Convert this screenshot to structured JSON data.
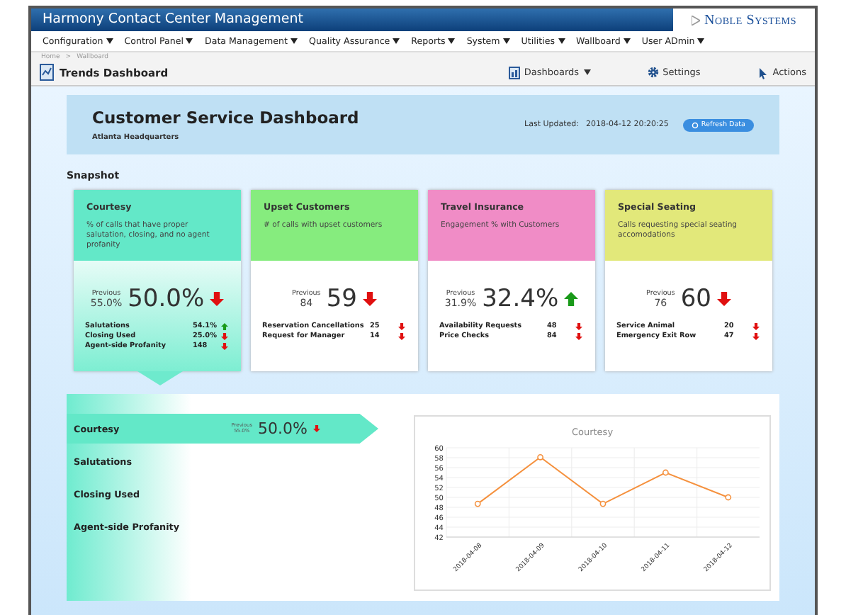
{
  "app": {
    "title": "Harmony Contact Center Management",
    "logo": "Noble Systems"
  },
  "menu": [
    {
      "label": "Configuration"
    },
    {
      "label": "Control Panel"
    },
    {
      "label": "Data Management"
    },
    {
      "label": "Quality Assurance"
    },
    {
      "label": "Reports"
    },
    {
      "label": "System"
    },
    {
      "label": "Utilities"
    },
    {
      "label": "Wallboard"
    },
    {
      "label": "User ADmin"
    }
  ],
  "breadcrumb": [
    "Home",
    ">",
    "Wallboard"
  ],
  "page": {
    "title": "Trends Dashboard",
    "actions": [
      {
        "kind": "dashboards",
        "label": "Dashboards"
      },
      {
        "kind": "settings",
        "label": "Settings"
      },
      {
        "kind": "actions",
        "label": "Actions"
      }
    ]
  },
  "header": {
    "title": "Customer Service Dashboard",
    "subtitle": "Atlanta Headquarters",
    "updated_label": "Last Updated:",
    "updated_value": "2018-04-12 20:20:25",
    "refresh": "Refresh Data"
  },
  "section": "Snapshot",
  "cards": [
    {
      "title": "Courtesy",
      "description": "% of calls that have proper salutation, closing, and no agent profanity",
      "color": "#63e8c8",
      "selected": true,
      "previous_label": "Previous",
      "previous": "55.0%",
      "value": "50.0%",
      "rising": false,
      "metrics": [
        {
          "name": "Salutations",
          "value": "54.1%",
          "rising": true
        },
        {
          "name": "Closing Used",
          "value": "25.0%",
          "rising": false
        },
        {
          "name": "Agent-side Profanity",
          "value": "148",
          "rising": false
        }
      ]
    },
    {
      "title": "Upset Customers",
      "description": "# of calls with upset customers",
      "color": "#86ec7e",
      "selected": false,
      "previous_label": "Previous",
      "previous": "84",
      "value": "59",
      "rising": false,
      "metrics": [
        {
          "name": "Reservation Cancellations",
          "value": "25",
          "rising": false
        },
        {
          "name": "Request for Manager",
          "value": "14",
          "rising": false
        }
      ]
    },
    {
      "title": "Travel Insurance",
      "description": "Engagement % with Customers",
      "color": "#f08cc6",
      "selected": false,
      "previous_label": "Previous",
      "previous": "31.9%",
      "value": "32.4%",
      "rising": true,
      "metrics": [
        {
          "name": "Availability Requests",
          "value": "48",
          "rising": false
        },
        {
          "name": "Price Checks",
          "value": "84",
          "rising": false
        }
      ]
    },
    {
      "title": "Special Seating",
      "description": "Calls requesting special seating accomodations",
      "color": "#e2e87a",
      "selected": false,
      "previous_label": "Previous",
      "previous": "76",
      "value": "60",
      "rising": false,
      "metrics": [
        {
          "name": "Service Animal",
          "value": "20",
          "rising": false
        },
        {
          "name": "Emergency Exit Row",
          "value": "47",
          "rising": false
        }
      ]
    }
  ],
  "detail": {
    "items": [
      {
        "label": "Courtesy",
        "selected": true,
        "previous_label": "Previous",
        "previous": "55.0%",
        "value": "50.0%",
        "rising": false
      },
      {
        "label": "Salutations",
        "selected": false
      },
      {
        "label": "Closing Used",
        "selected": false
      },
      {
        "label": "Agent-side Profanity",
        "selected": false
      }
    ],
    "chart_data": {
      "type": "line",
      "title": "Courtesy",
      "categories": [
        "2018-04-08",
        "2018-04-09",
        "2018-04-10",
        "2018-04-11",
        "2018-04-12"
      ],
      "grid": true,
      "series": [
        {
          "color": "#f5913e",
          "marker": "circle",
          "values": [
            48.7,
            58.1,
            48.7,
            55.0,
            50.0
          ]
        }
      ],
      "ylim": [
        42,
        60
      ],
      "yticks": [
        42,
        44,
        46,
        48,
        50,
        52,
        54,
        56,
        58,
        60
      ]
    }
  }
}
